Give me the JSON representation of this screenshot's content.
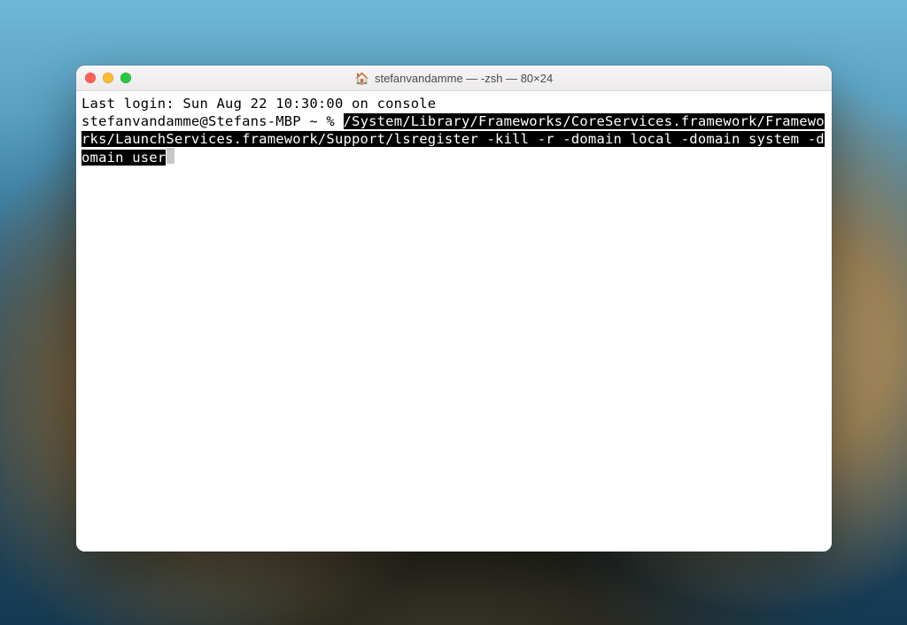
{
  "window": {
    "title": "stefanvandamme — -zsh — 80×24",
    "icon_name": "home-folder-icon"
  },
  "terminal": {
    "last_login_line": "Last login: Sun Aug 22 10:30:00 on console",
    "prompt": "stefanvandamme@Stefans-MBP ~ % ",
    "command": "/System/Library/Frameworks/CoreServices.framework/Frameworks/LaunchServices.framework/Support/lsregister -kill -r -domain local -domain system -domain user"
  },
  "traffic_lights": {
    "close": "close",
    "minimize": "minimize",
    "zoom": "zoom"
  }
}
